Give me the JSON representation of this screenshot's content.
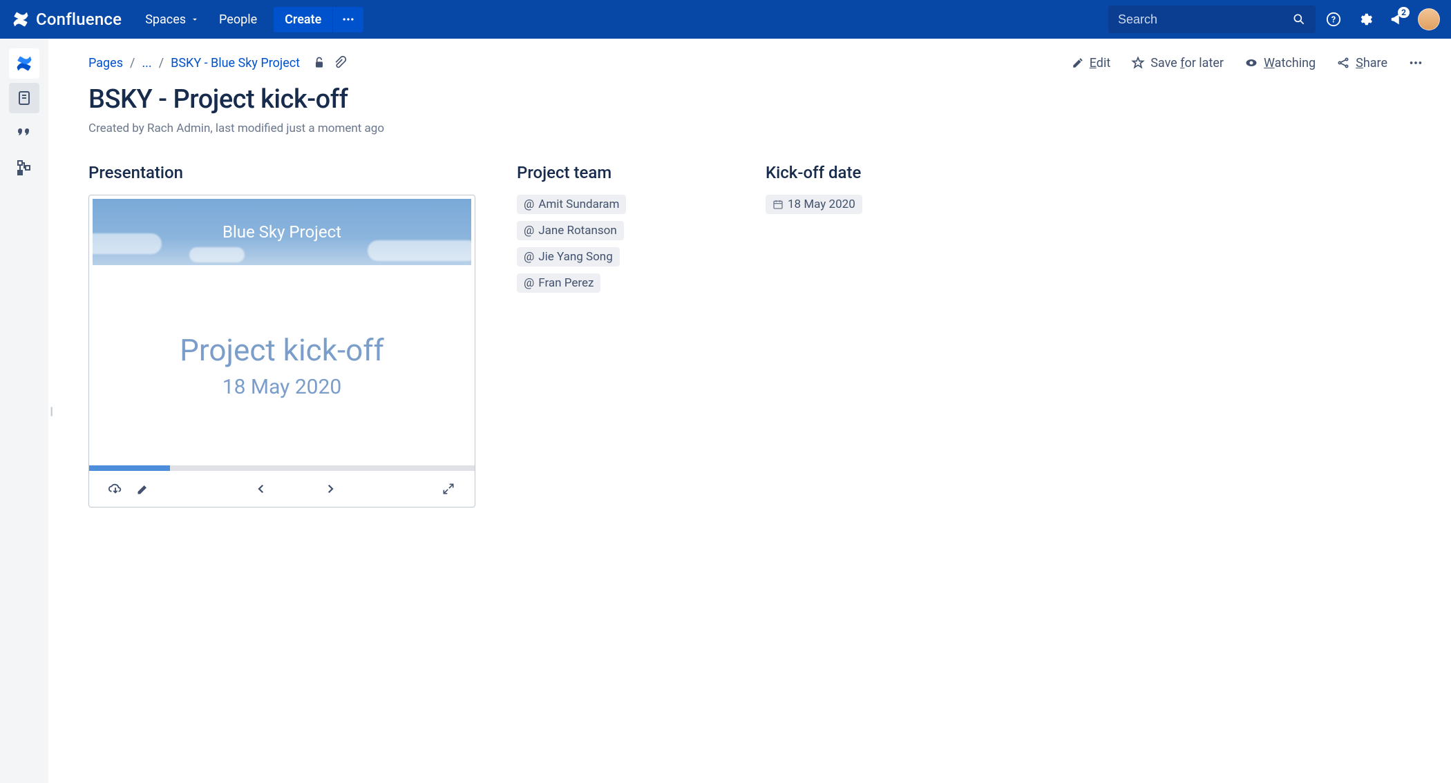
{
  "app": {
    "name": "Confluence"
  },
  "nav": {
    "spaces": "Spaces",
    "people": "People",
    "create": "Create",
    "search_placeholder": "Search",
    "notification_count": "2"
  },
  "breadcrumb": {
    "root": "Pages",
    "ellipsis": "...",
    "parent": "BSKY - Blue Sky Project"
  },
  "actions": {
    "edit_prefix": "E",
    "edit_rest": "dit",
    "save": "Save ",
    "save_u": "f",
    "save_rest": "or later",
    "watch_prefix": "W",
    "watch_rest": "atching",
    "share_prefix": "S",
    "share_rest": "hare"
  },
  "page": {
    "title": "BSKY - Project kick-off",
    "meta": "Created by Rach Admin, last modified just a moment ago"
  },
  "sections": {
    "presentation": "Presentation",
    "team": "Project team",
    "date": "Kick-off date"
  },
  "presentation": {
    "header": "Blue Sky Project",
    "title": "Project kick-off",
    "date": "18 May 2020"
  },
  "team": [
    "Amit Sundaram",
    "Jane Rotanson",
    "Jie Yang Song",
    "Fran Perez"
  ],
  "kickoff_date": "18 May 2020"
}
